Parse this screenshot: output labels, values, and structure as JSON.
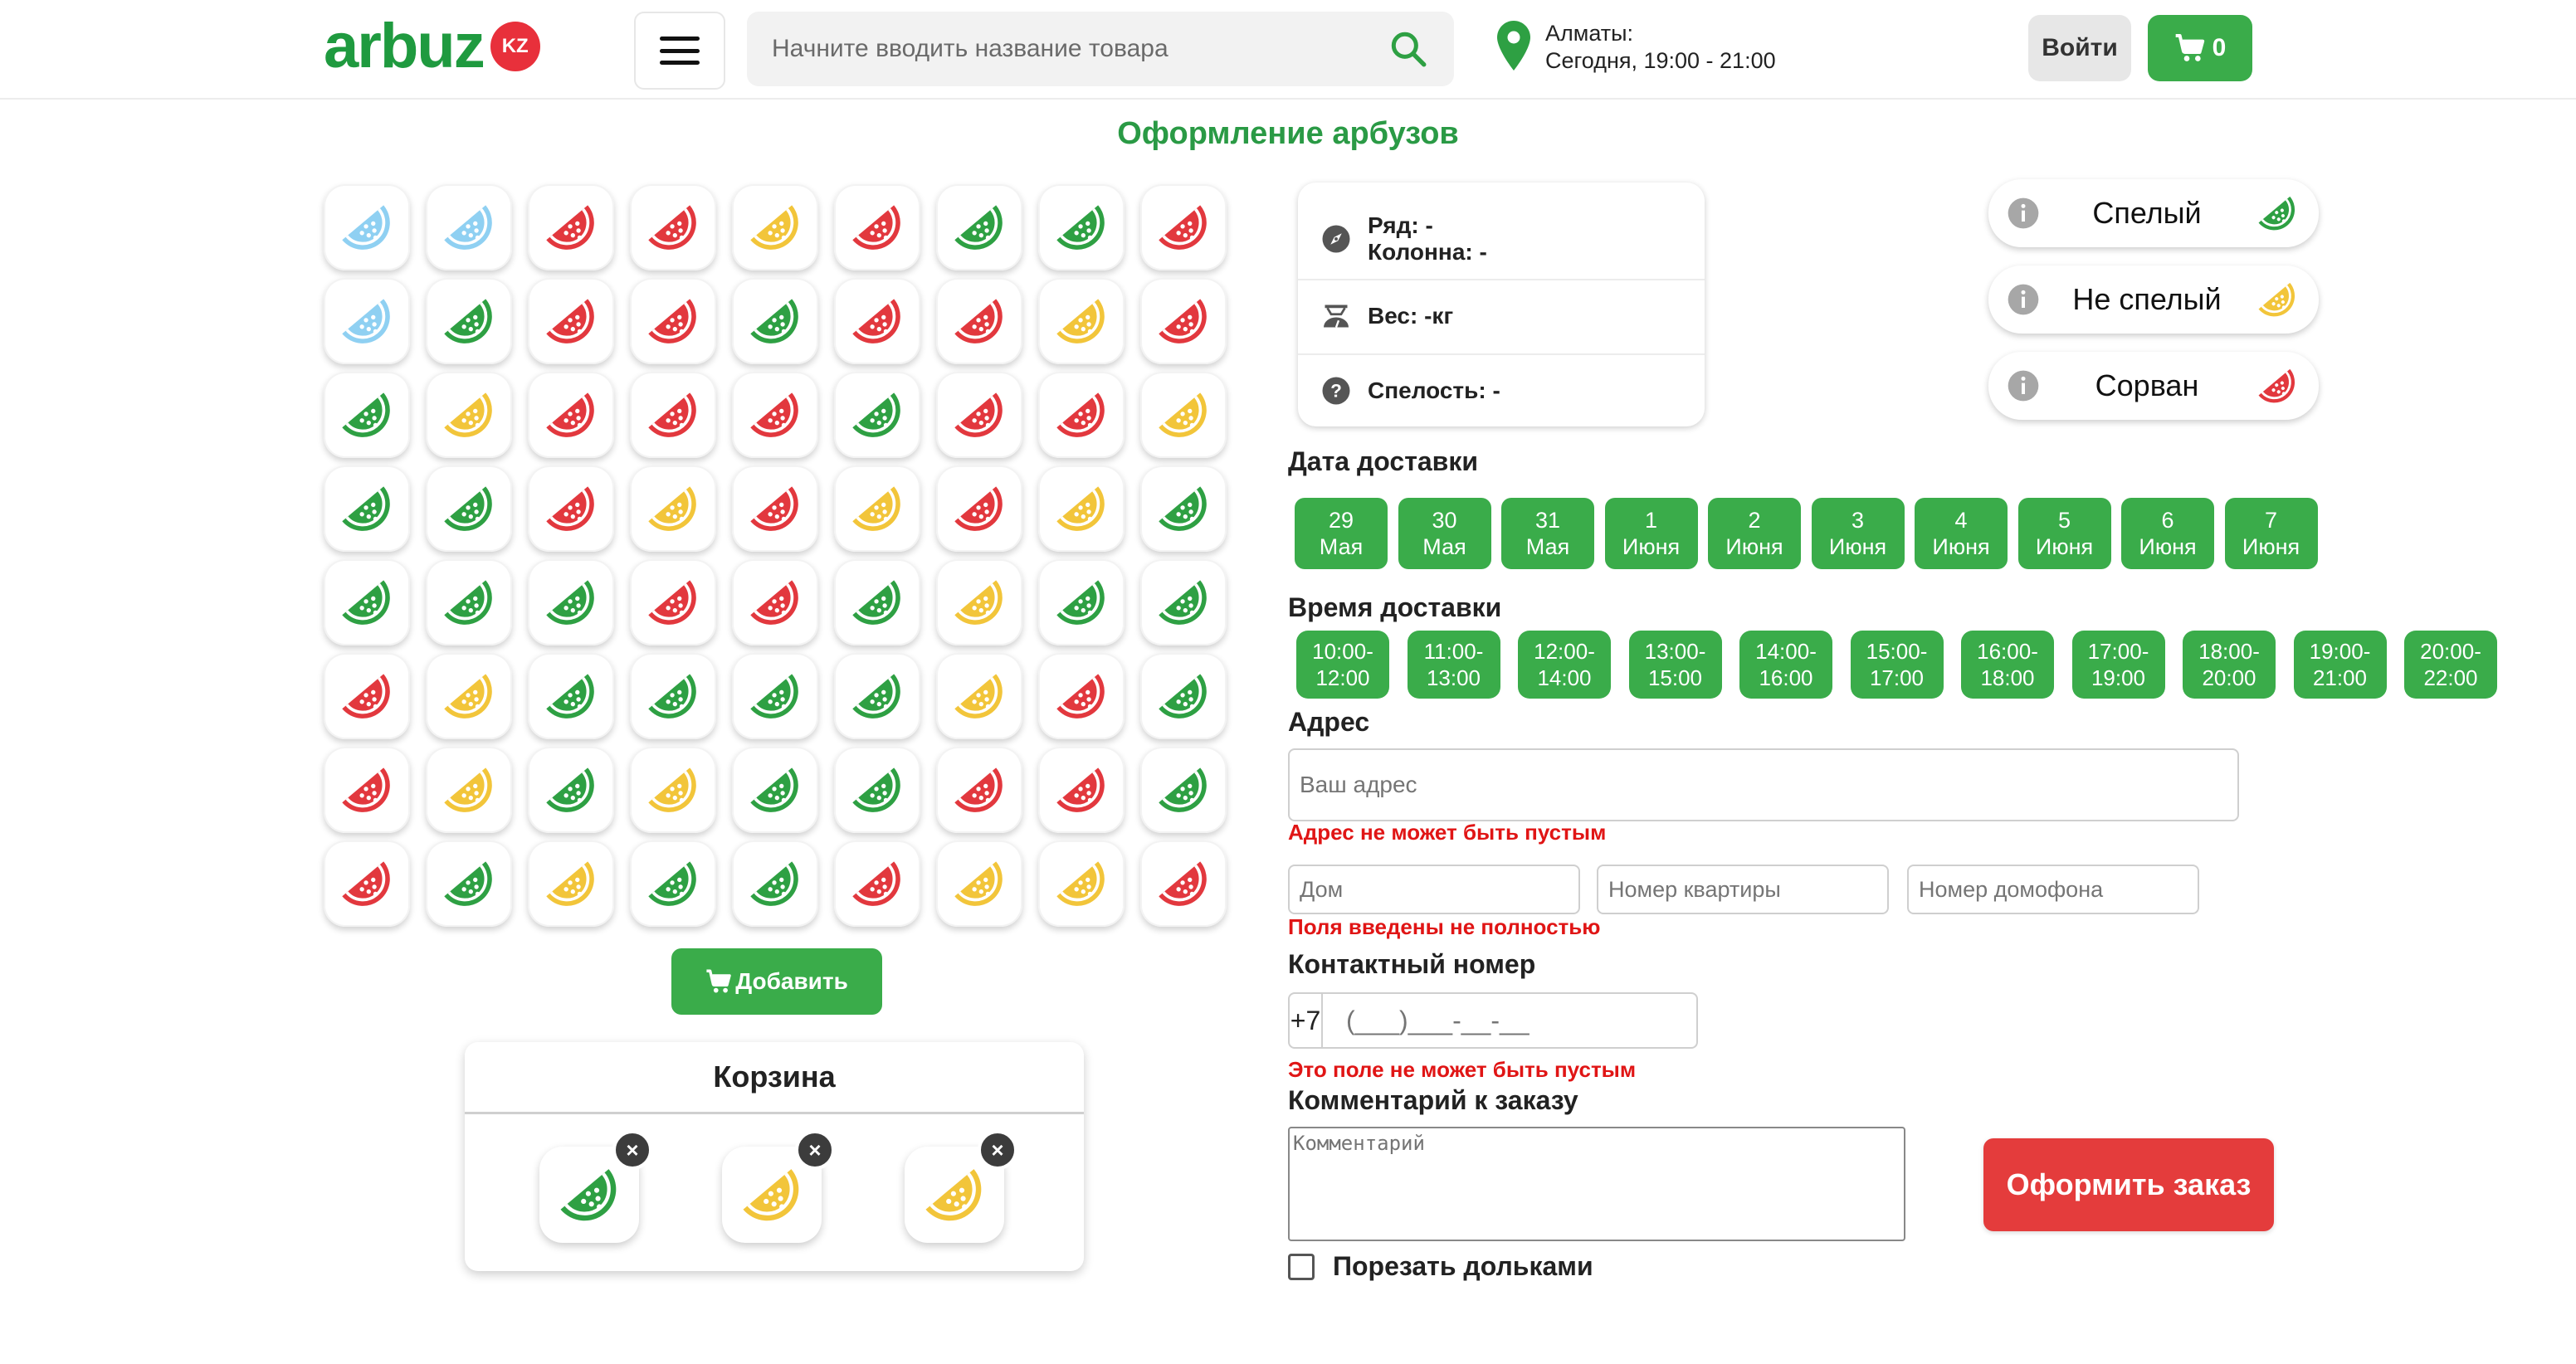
{
  "header": {
    "logo_text": "arbuz",
    "logo_badge": "KZ",
    "search_placeholder": "Начните вводить название товара",
    "location_city": "Алматы:",
    "location_time": "Сегодня, 19:00 - 21:00",
    "login_label": "Войти",
    "cart_count": "0",
    "brand_green": "#3aac4a"
  },
  "page_title": "Оформление арбузов",
  "watermelons": {
    "colors": {
      "ripe": "#2ea043",
      "unripe": "#f2c53a",
      "picked": "#e2383e",
      "empty": "#8fd0f2"
    },
    "grid": [
      [
        "empty",
        "empty",
        "picked",
        "picked",
        "unripe",
        "picked",
        "ripe",
        "ripe",
        "picked"
      ],
      [
        "empty",
        "ripe",
        "picked",
        "picked",
        "ripe",
        "picked",
        "picked",
        "unripe",
        "picked"
      ],
      [
        "ripe",
        "unripe",
        "picked",
        "picked",
        "picked",
        "ripe",
        "picked",
        "picked",
        "unripe"
      ],
      [
        "ripe",
        "ripe",
        "picked",
        "unripe",
        "picked",
        "unripe",
        "picked",
        "unripe",
        "ripe"
      ],
      [
        "ripe",
        "ripe",
        "ripe",
        "picked",
        "picked",
        "ripe",
        "unripe",
        "ripe",
        "ripe"
      ],
      [
        "picked",
        "unripe",
        "ripe",
        "ripe",
        "ripe",
        "ripe",
        "unripe",
        "picked",
        "ripe"
      ],
      [
        "picked",
        "unripe",
        "ripe",
        "unripe",
        "ripe",
        "ripe",
        "picked",
        "picked",
        "ripe"
      ],
      [
        "picked",
        "ripe",
        "unripe",
        "ripe",
        "ripe",
        "picked",
        "unripe",
        "unripe",
        "picked"
      ]
    ]
  },
  "add_button": "Добавить",
  "basket": {
    "title": "Корзина",
    "items": [
      "ripe",
      "unripe",
      "unripe"
    ],
    "remove_icon": "close-icon"
  },
  "info_card": {
    "row_label": "Ряд: -",
    "col_label": "Колонна: -",
    "weight_label": "Вес: -кг",
    "ripeness_label": "Спелость: -"
  },
  "legend": [
    {
      "label": "Спелый",
      "kind": "ripe"
    },
    {
      "label": "Не спелый",
      "kind": "unripe"
    },
    {
      "label": "Сорван",
      "kind": "picked"
    }
  ],
  "delivery_date": {
    "title": "Дата доставки",
    "dates": [
      {
        "day": "29",
        "month": "Мая"
      },
      {
        "day": "30",
        "month": "Мая"
      },
      {
        "day": "31",
        "month": "Мая"
      },
      {
        "day": "1",
        "month": "Июня"
      },
      {
        "day": "2",
        "month": "Июня"
      },
      {
        "day": "3",
        "month": "Июня"
      },
      {
        "day": "4",
        "month": "Июня"
      },
      {
        "day": "5",
        "month": "Июня"
      },
      {
        "day": "6",
        "month": "Июня"
      },
      {
        "day": "7",
        "month": "Июня"
      }
    ]
  },
  "delivery_time": {
    "title": "Время доставки",
    "slots": [
      {
        "from": "10:00-",
        "to": "12:00"
      },
      {
        "from": "11:00-",
        "to": "13:00"
      },
      {
        "from": "12:00-",
        "to": "14:00"
      },
      {
        "from": "13:00-",
        "to": "15:00"
      },
      {
        "from": "14:00-",
        "to": "16:00"
      },
      {
        "from": "15:00-",
        "to": "17:00"
      },
      {
        "from": "16:00-",
        "to": "18:00"
      },
      {
        "from": "17:00-",
        "to": "19:00"
      },
      {
        "from": "18:00-",
        "to": "20:00"
      },
      {
        "from": "19:00-",
        "to": "21:00"
      },
      {
        "from": "20:00-",
        "to": "22:00"
      }
    ]
  },
  "address": {
    "title": "Адрес",
    "placeholder": "Ваш адрес",
    "error": "Адрес не может быть пустым",
    "house_placeholder": "Дом",
    "apartment_placeholder": "Номер квартиры",
    "intercom_placeholder": "Номер домофона",
    "fields_error": "Поля введены не полностью"
  },
  "contact": {
    "title": "Контактный номер",
    "prefix": "+7",
    "mask": "(___)___-__-__",
    "error": "Это поле не может быть пустым"
  },
  "comment": {
    "title": "Комментарий к заказу",
    "placeholder": "Комментарий"
  },
  "order_button": "Оформить заказ",
  "slice_checkbox": {
    "label": "Порезать дольками",
    "checked": false
  }
}
